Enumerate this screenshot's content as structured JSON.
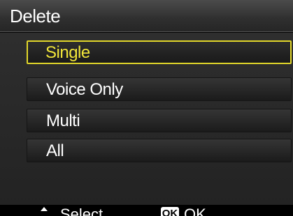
{
  "header": {
    "title": "Delete"
  },
  "menu": {
    "items": [
      {
        "label": "Single",
        "selected": true
      },
      {
        "label": "Voice Only",
        "selected": false
      },
      {
        "label": "Multi",
        "selected": false
      },
      {
        "label": "All",
        "selected": false
      }
    ]
  },
  "footer": {
    "select_icon": "up-down-arrow-icon",
    "select_label": "Select",
    "ok_badge": "OK",
    "ok_label": "OK"
  },
  "colors": {
    "highlight": "#e2d72a",
    "selected_text": "#f0e53a",
    "background": "#000000"
  }
}
